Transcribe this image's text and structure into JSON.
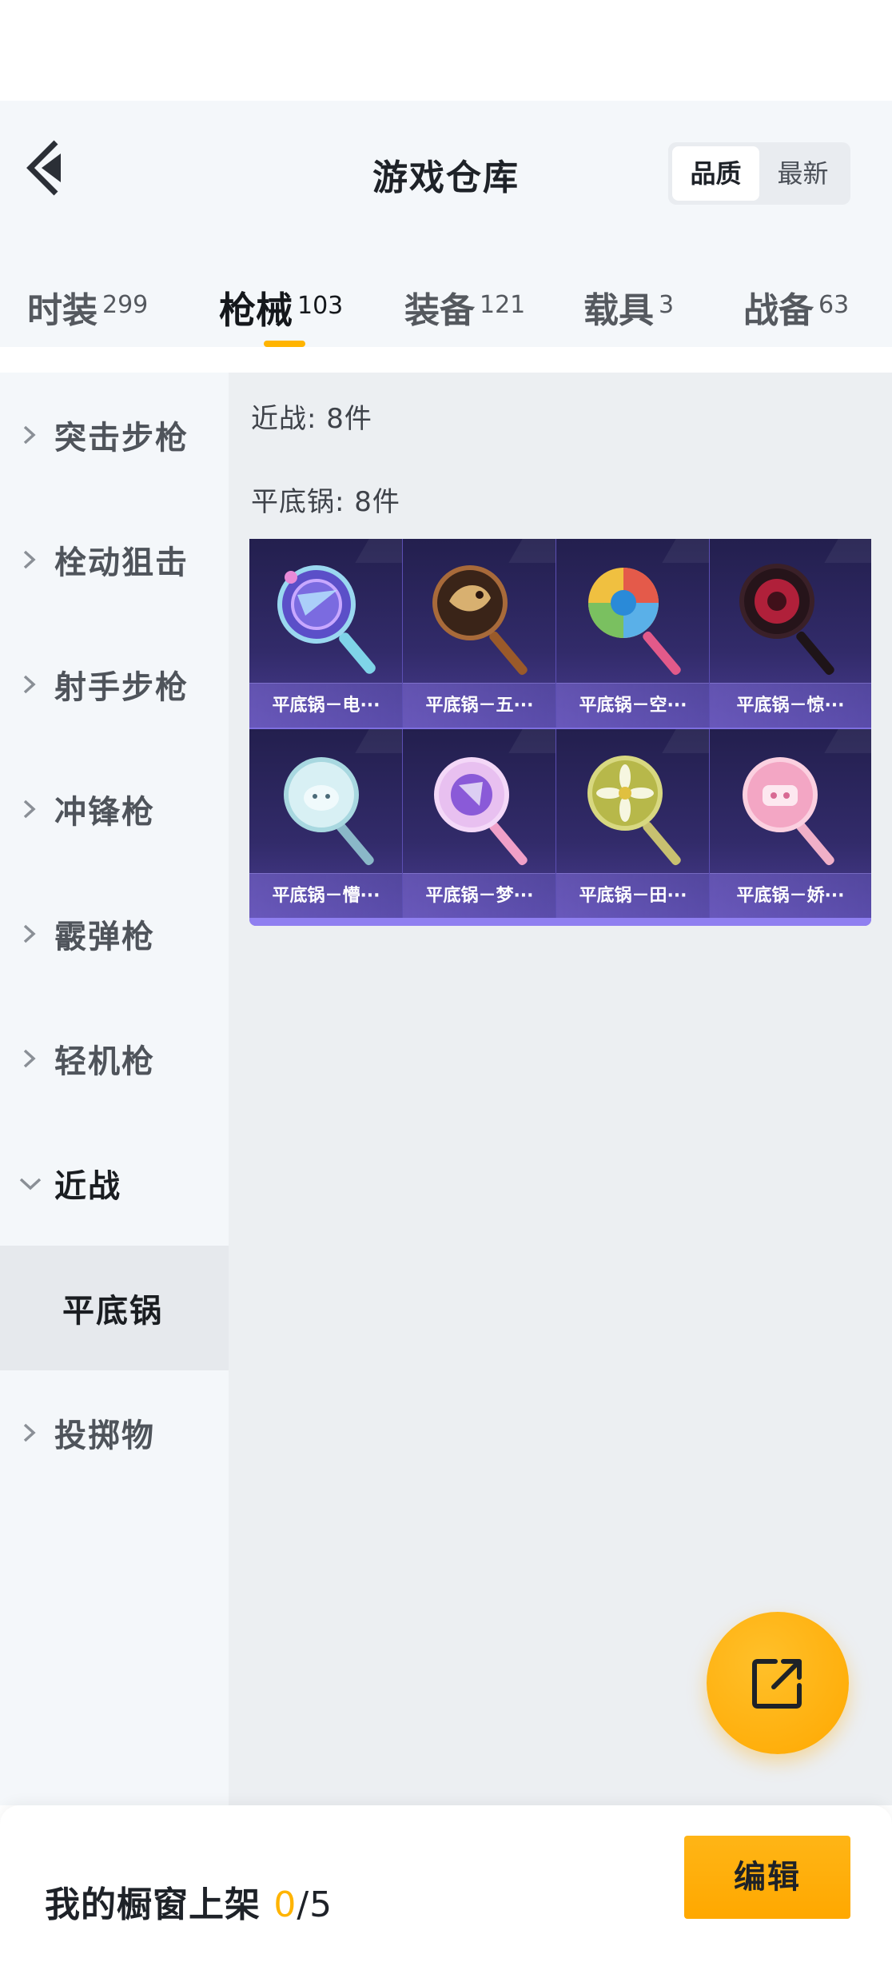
{
  "header": {
    "title": "游戏仓库",
    "sort": {
      "options": [
        "品质",
        "最新"
      ],
      "selected": "品质"
    }
  },
  "tabs": [
    {
      "label": "时装",
      "count": "299",
      "active": false
    },
    {
      "label": "枪械",
      "count": "103",
      "active": true
    },
    {
      "label": "装备",
      "count": "121",
      "active": false
    },
    {
      "label": "载具",
      "count": "3",
      "active": false
    },
    {
      "label": "战备",
      "count": "63",
      "active": false
    }
  ],
  "sidebar": {
    "items": [
      {
        "label": "突击步枪",
        "state": "collapsed"
      },
      {
        "label": "栓动狙击",
        "state": "collapsed"
      },
      {
        "label": "射手步枪",
        "state": "collapsed"
      },
      {
        "label": "冲锋枪",
        "state": "collapsed"
      },
      {
        "label": "霰弹枪",
        "state": "collapsed"
      },
      {
        "label": "轻机枪",
        "state": "collapsed"
      },
      {
        "label": "近战",
        "state": "expanded"
      },
      {
        "label": "平底锅",
        "state": "selected-sub"
      },
      {
        "label": "投掷物",
        "state": "collapsed"
      }
    ]
  },
  "content": {
    "category_heading": "近战: 8件",
    "subcategory_heading": "平底锅: 8件",
    "items": [
      {
        "name": "平底锅－电···",
        "icon": "pan-electric-icon",
        "accent": "#7b6be0"
      },
      {
        "name": "平底锅－五···",
        "icon": "pan-dragon-icon",
        "accent": "#8a5a34"
      },
      {
        "name": "平底锅－空···",
        "icon": "pan-rainbow-icon",
        "accent": "#e45a4a"
      },
      {
        "name": "平底锅－惊···",
        "icon": "pan-dark-red-icon",
        "accent": "#b0203a"
      },
      {
        "name": "平底锅－懵···",
        "icon": "pan-cat-icon",
        "accent": "#bfe6ee"
      },
      {
        "name": "平底锅－梦···",
        "icon": "pan-dream-icon",
        "accent": "#b48ae8"
      },
      {
        "name": "平底锅－田···",
        "icon": "pan-flower-icon",
        "accent": "#b7b84a"
      },
      {
        "name": "平底锅－娇···",
        "icon": "pan-pink-icon",
        "accent": "#f3a6c4"
      }
    ]
  },
  "fab": {
    "icon": "share-icon"
  },
  "footer": {
    "label": "我的橱窗上架",
    "used": "0",
    "total": "/5",
    "edit_label": "编辑"
  },
  "colors": {
    "accent": "#ffb400",
    "card_bg": "#2b2560",
    "card_border": "#7d6ee0"
  }
}
